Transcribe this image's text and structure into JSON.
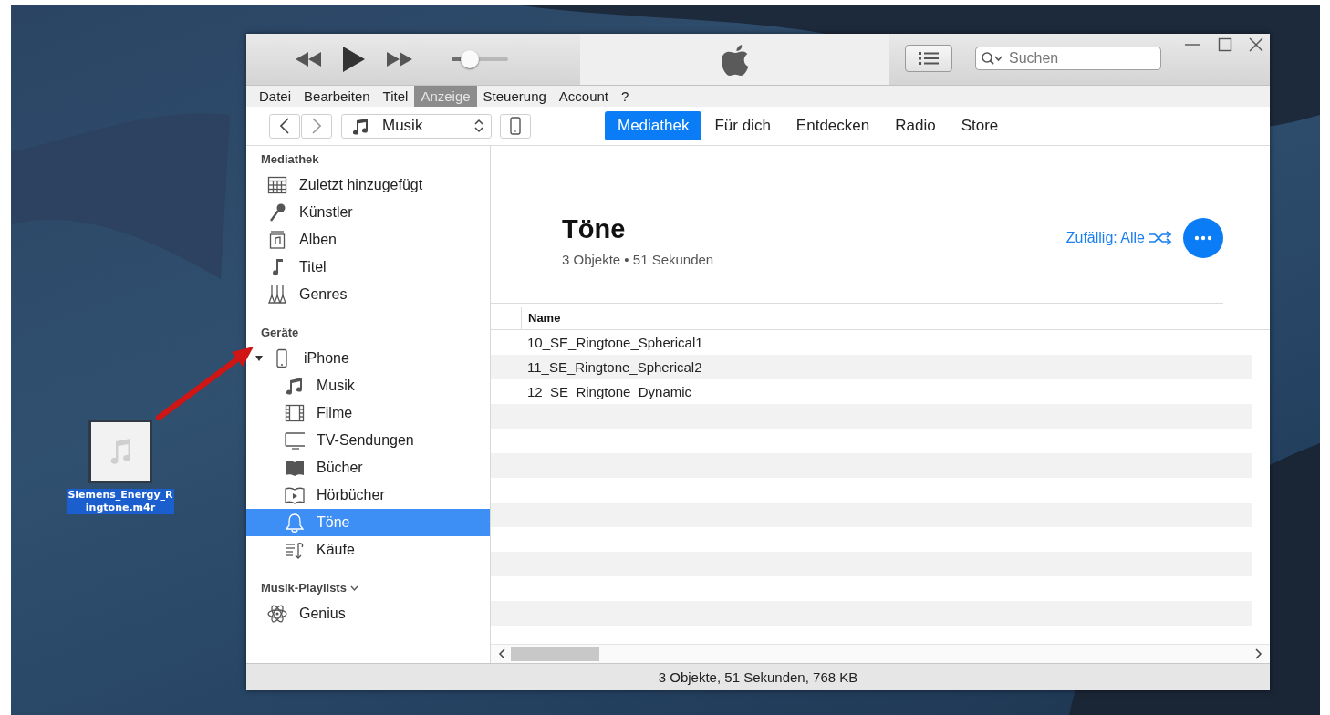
{
  "desktop_file": {
    "label": "Siemens_Energy_Ringtone.m4r",
    "selected": true
  },
  "player": {
    "volume": {
      "level": 0.33
    }
  },
  "search": {
    "placeholder": "Suchen"
  },
  "menu": [
    {
      "label": "Datei",
      "selected": false
    },
    {
      "label": "Bearbeiten",
      "selected": false
    },
    {
      "label": "Titel",
      "selected": false
    },
    {
      "label": "Anzeige",
      "selected": true
    },
    {
      "label": "Steuerung",
      "selected": false
    },
    {
      "label": "Account",
      "selected": false
    },
    {
      "label": "?",
      "selected": false
    }
  ],
  "media_picker": {
    "value": "Musik"
  },
  "tabs": [
    {
      "label": "Mediathek",
      "selected": true
    },
    {
      "label": "Für dich",
      "selected": false
    },
    {
      "label": "Entdecken",
      "selected": false
    },
    {
      "label": "Radio",
      "selected": false
    },
    {
      "label": "Store",
      "selected": false
    }
  ],
  "sidebar": {
    "sections": [
      {
        "title": "Mediathek",
        "items": [
          {
            "label": "Zuletzt hinzugefügt",
            "selected": false
          },
          {
            "label": "Künstler",
            "selected": false
          },
          {
            "label": "Alben",
            "selected": false
          },
          {
            "label": "Titel",
            "selected": false
          },
          {
            "label": "Genres",
            "selected": false
          }
        ]
      },
      {
        "title": "Geräte",
        "items": [
          {
            "label": "iPhone",
            "selected": false,
            "expanded": true,
            "children": [
              {
                "label": "Musik",
                "selected": false
              },
              {
                "label": "Filme",
                "selected": false
              },
              {
                "label": "TV-Sendungen",
                "selected": false
              },
              {
                "label": "Bücher",
                "selected": false
              },
              {
                "label": "Hörbücher",
                "selected": false
              },
              {
                "label": "Töne",
                "selected": true
              },
              {
                "label": "Käufe",
                "selected": false
              }
            ]
          }
        ]
      },
      {
        "title": "Musik-Playlists",
        "expanded": true,
        "items": [
          {
            "label": "Genius",
            "selected": false
          }
        ]
      }
    ]
  },
  "header": {
    "title": "Töne",
    "subtitle": "3 Objekte • 51 Sekunden",
    "shuffle": "Zufällig: Alle"
  },
  "table": {
    "columns": [
      "Name"
    ],
    "rows": [
      {
        "name": "10_SE_Ringtone_Spherical1"
      },
      {
        "name": "11_SE_Ringtone_Spherical2"
      },
      {
        "name": "12_SE_Ringtone_Dynamic"
      }
    ]
  },
  "status_bar": "3 Objekte, 51 Sekunden, 768 KB"
}
